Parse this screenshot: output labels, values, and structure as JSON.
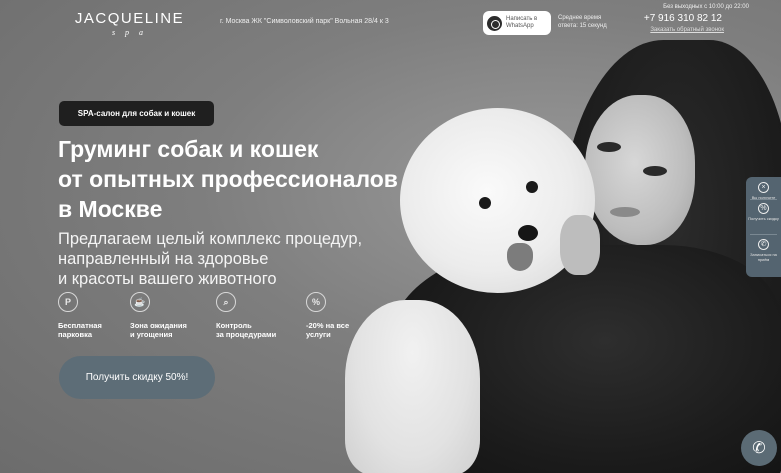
{
  "header": {
    "logo": "JACQUELINE",
    "logo_sub": "s p a",
    "address": "г. Москва ЖК \"Символовский парк\" Вольная 28/4 к 3",
    "whatsapp_label": "Написать в WhatsApp",
    "response_time": "Среднее время ответа: 15 секунд",
    "hours": "Без выходных с 10:00 до 22:00",
    "phone": "+7 916 310 82 12",
    "callback": "Заказать обратный звонок"
  },
  "hero": {
    "badge": "SPA-салон для собак и кошек",
    "title_lines": [
      "Груминг собак и кошек",
      "от опытных профессионалов",
      "в Москве"
    ],
    "subtitle_lines": [
      "Предлагаем целый комплекс процедур,",
      "направленный на здоровье",
      "и красоты вашего животного"
    ],
    "features": [
      {
        "icon": "parking-icon",
        "line1": "Бесплатная",
        "line2": "парковка"
      },
      {
        "icon": "waiting-zone-icon",
        "line1": "Зона ожидания",
        "line2": "и угощения"
      },
      {
        "icon": "magnifier-icon",
        "line1": "Контроль",
        "line2": "за процедурами"
      },
      {
        "icon": "percent-icon",
        "line1": "-20% на все",
        "line2": "услуги"
      }
    ],
    "cta": "Получить скидку 50%!"
  },
  "side_widget": {
    "items": [
      "Вы получите",
      "Получить скидку",
      "Записаться на приём"
    ]
  },
  "colors": {
    "accent": "#5d6d77",
    "badge_bg": "#1f1f1f"
  }
}
